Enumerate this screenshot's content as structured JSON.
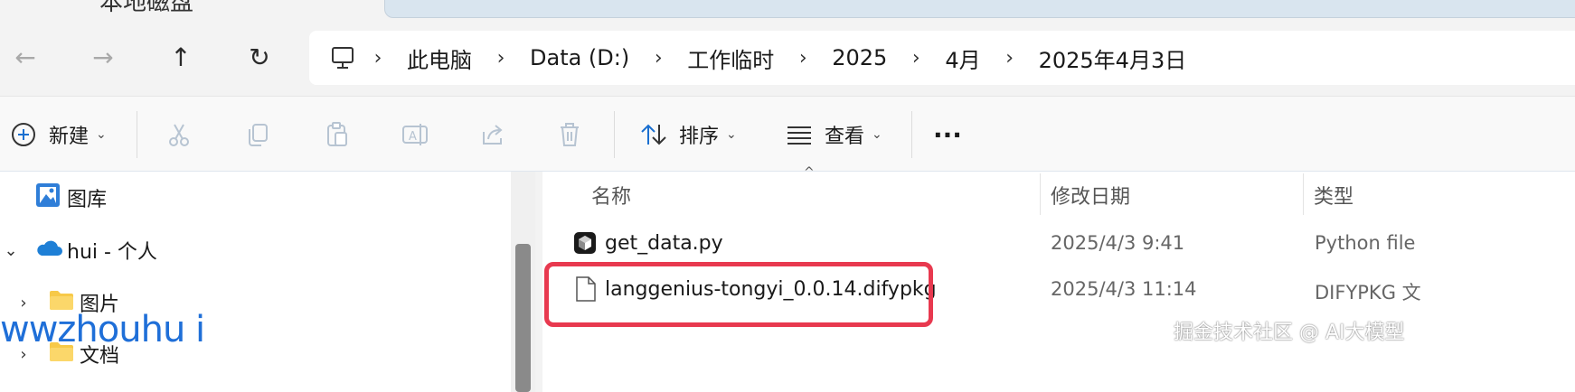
{
  "window": {
    "title_partial": "本地磁盘"
  },
  "address": {
    "crumbs": [
      "此电脑",
      "Data (D:)",
      "工作临时",
      "2025",
      "4月",
      "2025年4月3日"
    ]
  },
  "commands": {
    "new_label": "新建",
    "sort_label": "排序",
    "view_label": "查看",
    "more_label": "···"
  },
  "nav_tree": {
    "items": [
      {
        "label": "图库"
      },
      {
        "label": "hui - 个人"
      },
      {
        "label": "图片"
      },
      {
        "label": "文档"
      }
    ]
  },
  "columns": {
    "name": "名称",
    "modified": "修改日期",
    "type": "类型"
  },
  "files": [
    {
      "name": "get_data.py",
      "modified": "2025/4/3 9:41",
      "type": "Python file"
    },
    {
      "name": "langgenius-tongyi_0.0.14.difypkg",
      "modified": "2025/4/3 11:14",
      "type": "DIFYPKG 文"
    }
  ],
  "watermarks": {
    "left": "wwzhouhu i",
    "right": "掘金技术社区 @ AI大模型"
  },
  "colors": {
    "highlight": "#e8394f",
    "watermark_blue": "#1f6fd8",
    "folder": "#f7c948",
    "onedrive": "#1e7fd6"
  }
}
